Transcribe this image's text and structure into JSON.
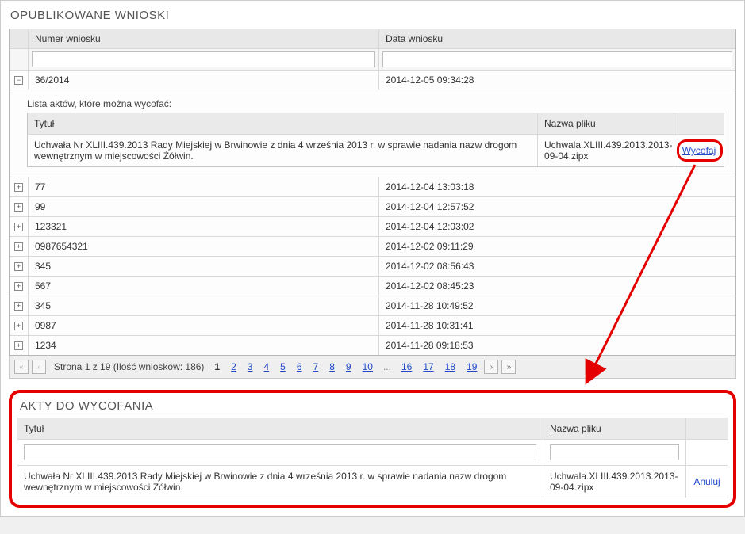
{
  "published": {
    "title": "OPUBLIKOWANE WNIOSKI",
    "headers": {
      "expand": "",
      "num": "Numer wniosku",
      "date": "Data wniosku"
    },
    "rows": [
      {
        "expanded": true,
        "num": "36/2014",
        "date": "2014-12-05 09:34:28"
      },
      {
        "expanded": false,
        "num": "77",
        "date": "2014-12-04 13:03:18"
      },
      {
        "expanded": false,
        "num": "99",
        "date": "2014-12-04 12:57:52"
      },
      {
        "expanded": false,
        "num": "123321",
        "date": "2014-12-04 12:03:02"
      },
      {
        "expanded": false,
        "num": "0987654321",
        "date": "2014-12-02 09:11:29"
      },
      {
        "expanded": false,
        "num": "345",
        "date": "2014-12-02 08:56:43"
      },
      {
        "expanded": false,
        "num": "567",
        "date": "2014-12-02 08:45:23"
      },
      {
        "expanded": false,
        "num": "345",
        "date": "2014-11-28 10:49:52"
      },
      {
        "expanded": false,
        "num": "0987",
        "date": "2014-11-28 10:31:41"
      },
      {
        "expanded": false,
        "num": "1234",
        "date": "2014-11-28 09:18:53"
      }
    ],
    "detail": {
      "caption": "Lista aktów, które można wycofać:",
      "headers": {
        "tytul": "Tytuł",
        "plik": "Nazwa pliku",
        "action": ""
      },
      "row": {
        "tytul": "Uchwała Nr XLIII.439.2013 Rady Miejskiej w Brwinowie z dnia 4 września 2013 r. w sprawie nadania nazw drogom wewnętrznym w miejscowości Żółwin.",
        "plik": "Uchwala.XLIII.439.2013.2013-09-04.zipx",
        "action": "Wycofaj"
      }
    },
    "pager": {
      "status": "Strona 1 z 19 (Ilość wniosków: 186)",
      "pages_a": [
        "1",
        "2",
        "3",
        "4",
        "5",
        "6",
        "7",
        "8",
        "9",
        "10"
      ],
      "ellipsis": "...",
      "pages_b": [
        "16",
        "17",
        "18",
        "19"
      ]
    }
  },
  "withdraw": {
    "title": "AKTY DO WYCOFANIA",
    "headers": {
      "tytul": "Tytuł",
      "plik": "Nazwa pliku",
      "action": ""
    },
    "row": {
      "tytul": "Uchwała Nr XLIII.439.2013 Rady Miejskiej w Brwinowie z dnia 4 września 2013 r. w sprawie nadania nazw drogom wewnętrznym w miejscowości Żółwin.",
      "plik": "Uchwala.XLIII.439.2013.2013-09-04.zipx",
      "action": "Anuluj"
    }
  },
  "glyph": {
    "plus": "+",
    "minus": "−",
    "first": "«",
    "prev": "‹",
    "next": "›",
    "last": "»"
  }
}
